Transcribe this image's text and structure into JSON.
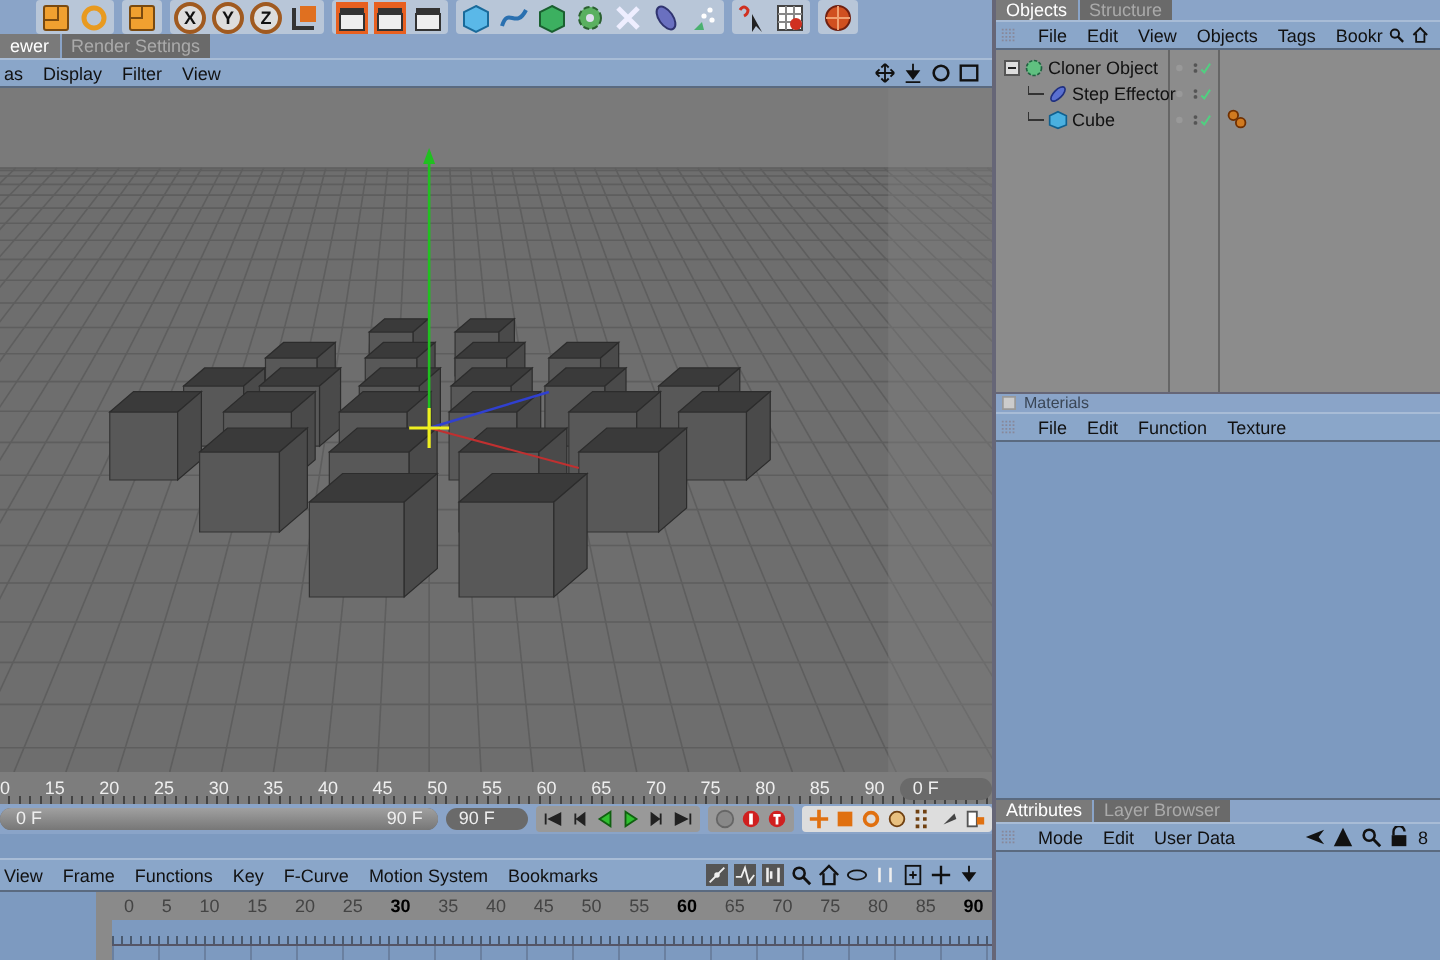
{
  "toolbar": {
    "axis_buttons": [
      "X",
      "Y",
      "Z"
    ]
  },
  "viewport_tabs": [
    {
      "label": "ewer",
      "selected": true
    },
    {
      "label": "Render Settings",
      "selected": false
    }
  ],
  "viewport_menu": [
    "as",
    "Display",
    "Filter",
    "View"
  ],
  "timeline": {
    "ruler": [
      "0",
      "15",
      "20",
      "25",
      "30",
      "35",
      "40",
      "45",
      "50",
      "55",
      "60",
      "65",
      "70",
      "75",
      "80",
      "85",
      "90"
    ],
    "current_frame": "0 F",
    "range_slider": {
      "start": "0 F",
      "end": "90 F",
      "level": 1
    },
    "end_frame": "90 F"
  },
  "fcurve_menu": [
    "View",
    "Frame",
    "Functions",
    "Key",
    "F-Curve",
    "Motion System",
    "Bookmarks"
  ],
  "fcurve_ruler": [
    {
      "label": "0",
      "major": false
    },
    {
      "label": "5",
      "major": false
    },
    {
      "label": "10",
      "major": false
    },
    {
      "label": "15",
      "major": false
    },
    {
      "label": "20",
      "major": false
    },
    {
      "label": "25",
      "major": false
    },
    {
      "label": "30",
      "major": true
    },
    {
      "label": "35",
      "major": false
    },
    {
      "label": "40",
      "major": false
    },
    {
      "label": "45",
      "major": false
    },
    {
      "label": "50",
      "major": false
    },
    {
      "label": "55",
      "major": false
    },
    {
      "label": "60",
      "major": true
    },
    {
      "label": "65",
      "major": false
    },
    {
      "label": "70",
      "major": false
    },
    {
      "label": "75",
      "major": false
    },
    {
      "label": "80",
      "major": false
    },
    {
      "label": "85",
      "major": false
    },
    {
      "label": "90",
      "major": true
    }
  ],
  "objects_tabs": [
    {
      "label": "Objects",
      "selected": true
    },
    {
      "label": "Structure",
      "selected": false
    }
  ],
  "objects_menu": [
    "File",
    "Edit",
    "View",
    "Objects",
    "Tags",
    "Bookr"
  ],
  "objects_tree": [
    {
      "name": "Cloner Object",
      "kind": "cloner",
      "expanded": true,
      "has_tag": false,
      "children": [
        {
          "name": "Step Effector",
          "kind": "effector",
          "has_tag": false
        },
        {
          "name": "Cube",
          "kind": "cube",
          "has_tag": true
        }
      ]
    }
  ],
  "materials": {
    "title": "Materials",
    "menu": [
      "File",
      "Edit",
      "Function",
      "Texture"
    ]
  },
  "attributes_tabs": [
    {
      "label": "Attributes",
      "selected": true
    },
    {
      "label": "Layer Browser",
      "selected": false
    }
  ],
  "attributes_menu": [
    "Mode",
    "Edit",
    "User Data"
  ],
  "attributes_count": "8"
}
